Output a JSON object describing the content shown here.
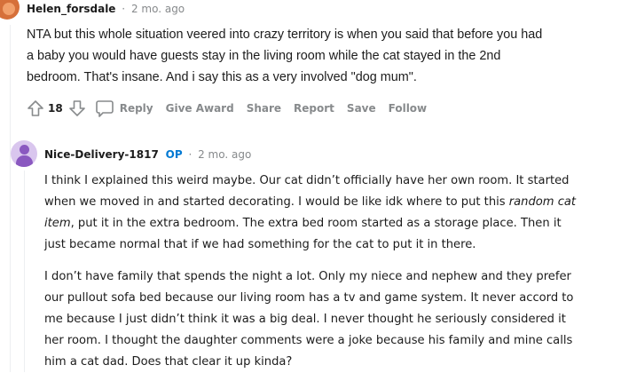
{
  "comment1": {
    "author": "Helen_forsdale",
    "separator": "·",
    "time": "2 mo. ago",
    "lines": [
      "NTA but this whole situation veered into crazy territory is when you said that before you had",
      "a baby you would have guests stay in the living room while the cat stayed in the 2nd",
      "bedroom. That's insane. And i say this as a very involved \"dog mum\"."
    ],
    "score": "18",
    "actions": {
      "reply": "Reply",
      "give_award": "Give Award",
      "share": "Share",
      "report": "Report",
      "save": "Save",
      "follow": "Follow"
    }
  },
  "comment2": {
    "author": "Nice-Delivery-1817",
    "op_badge": "OP",
    "separator": "·",
    "time": "2 mo. ago",
    "p1": {
      "line1": "I think I explained this weird maybe. Our cat didn’t officially have her own room. It started",
      "line2": "when we moved in and started decorating. I would be like idk where to put this ",
      "line2_italic": "random cat",
      "line3_italic": "item",
      "line3": ", put it in the extra bedroom. The extra bed room started as a storage place. Then it",
      "line4": "just became normal that if we had something for the cat to put it in there."
    },
    "p2": [
      "I don’t have family that spends the night a lot. Only my niece and nephew and they prefer",
      "our pullout sofa bed because our living room has a tv and game system. It never accord to",
      "me because I just didn’t think it was a big deal. I never thought he seriously considered it",
      "her room. I thought the daughter comments were a joke because his family and mine calls",
      "him a cat dad. Does that clear it up kinda?"
    ]
  },
  "colors": {
    "text": "#1c1c1c",
    "meta": "#878a8c",
    "op": "#0079d3",
    "avatar1": "#d6703a",
    "avatar2": "#d9c6ee"
  },
  "icons": [
    "user-avatar",
    "upvote-arrow-icon",
    "downvote-arrow-icon",
    "comment-bubble-icon",
    "user-avatar"
  ]
}
